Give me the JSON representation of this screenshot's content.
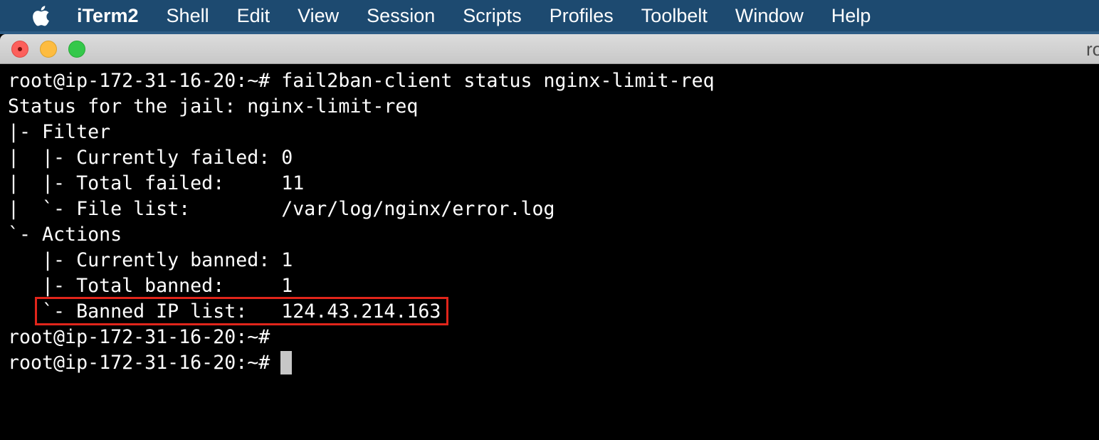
{
  "menubar": {
    "apple_icon": "apple-logo-icon",
    "items": [
      "iTerm2",
      "Shell",
      "Edit",
      "View",
      "Session",
      "Scripts",
      "Profiles",
      "Toolbelt",
      "Window",
      "Help"
    ]
  },
  "window": {
    "title_fragment": "ro"
  },
  "terminal": {
    "lines": [
      "root@ip-172-31-16-20:~# fail2ban-client status nginx-limit-req",
      "Status for the jail: nginx-limit-req",
      "|- Filter",
      "|  |- Currently failed: 0",
      "|  |- Total failed:     11",
      "|  `- File list:        /var/log/nginx/error.log",
      "`- Actions",
      "   |- Currently banned: 1",
      "   |- Total banned:     1",
      "   `- Banned IP list:   124.43.214.163",
      "root@ip-172-31-16-20:~#",
      "root@ip-172-31-16-20:~# "
    ]
  },
  "colors": {
    "menubar_bg": "#1d4a70",
    "terminal_bg": "#000000",
    "terminal_fg": "#ffffff",
    "highlight": "#e1251b",
    "cursor": "#c7c7c7"
  }
}
